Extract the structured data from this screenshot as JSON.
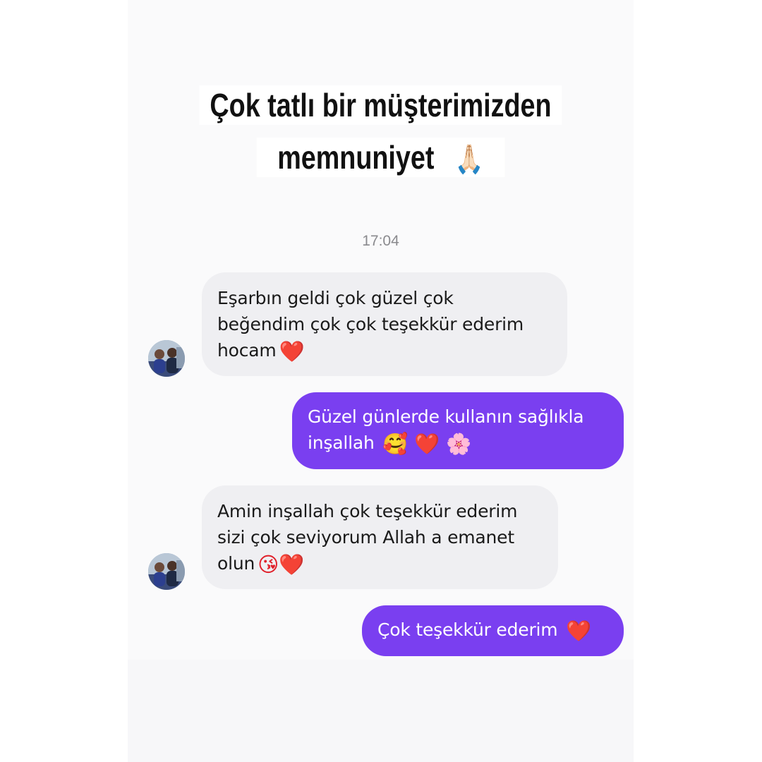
{
  "caption": {
    "line1": "Çok tatlı bir müşterimizden",
    "line2": "memnuniyet",
    "emoji": "🙏🏻"
  },
  "chat": {
    "timestamp": "17:04",
    "messages": [
      {
        "sender": "customer",
        "lines": [
          "Eşarbın geldi çok güzel çok",
          "beğendim çok çok teşekkür ederim",
          "hocam"
        ],
        "emoji": "❤️"
      },
      {
        "sender": "shop",
        "lines": [
          "Güzel günlerde kullanın sağlıkla",
          "inşallah"
        ],
        "emoji": "🥰 ❤️ 🌸"
      },
      {
        "sender": "customer",
        "lines": [
          "Amin inşallah çok teşekkür ederim",
          "sizi çok seviyorum Allah a emanet",
          "olun"
        ],
        "emoji": "😘❤️"
      },
      {
        "sender": "shop",
        "lines": [
          "Çok teşekkür ederim"
        ],
        "emoji": "❤️"
      }
    ]
  },
  "colors": {
    "incoming_bubble": "#efeff2",
    "outgoing_bubble": "#7a3ff0",
    "heart": "#e0202a"
  },
  "icons": {
    "avatar": "user-avatar-photo"
  }
}
